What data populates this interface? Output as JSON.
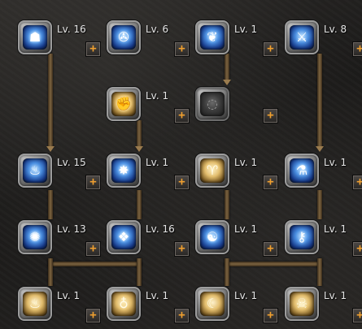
{
  "skill_tree": {
    "nodes": [
      {
        "id": "r1c1",
        "level_label": "Lv. 16",
        "plus_label": "+",
        "icon": "spirit-bust-icon",
        "style": "blue"
      },
      {
        "id": "r1c2",
        "level_label": "Lv. 6",
        "plus_label": "+",
        "icon": "spinning-wheel-icon",
        "style": "blue"
      },
      {
        "id": "r1c3",
        "level_label": "Lv. 1",
        "plus_label": "+",
        "icon": "rabbit-spirit-icon",
        "style": "blue"
      },
      {
        "id": "r1c4",
        "level_label": "Lv. 8",
        "plus_label": "+",
        "icon": "sword-icon",
        "style": "blue"
      },
      {
        "id": "r2c2",
        "level_label": "Lv. 1",
        "plus_label": "+",
        "icon": "fist-strike-icon",
        "style": "gold"
      },
      {
        "id": "r2c3",
        "level_label": "",
        "plus_label": "+",
        "icon": "locked-halo-icon",
        "style": "locked"
      },
      {
        "id": "r3c1",
        "level_label": "Lv. 15",
        "plus_label": "+",
        "icon": "spirit-summon-icon",
        "style": "blue"
      },
      {
        "id": "r3c2",
        "level_label": "Lv. 1",
        "plus_label": "+",
        "icon": "burst-icon",
        "style": "blue"
      },
      {
        "id": "r3c3",
        "level_label": "Lv. 1",
        "plus_label": "+",
        "icon": "ram-horns-icon",
        "style": "gold"
      },
      {
        "id": "r3c4",
        "level_label": "Lv. 1",
        "plus_label": "+",
        "icon": "potion-flask-icon",
        "style": "blue"
      },
      {
        "id": "r4c1",
        "level_label": "Lv. 13",
        "plus_label": "+",
        "icon": "spirit-storm-icon",
        "style": "blue"
      },
      {
        "id": "r4c2",
        "level_label": "Lv. 16",
        "plus_label": "+",
        "icon": "crystal-shards-icon",
        "style": "blue"
      },
      {
        "id": "r4c3",
        "level_label": "Lv. 1",
        "plus_label": "+",
        "icon": "meditation-orb-icon",
        "style": "blue"
      },
      {
        "id": "r4c4",
        "level_label": "Lv. 1",
        "plus_label": "+",
        "icon": "key-staff-icon",
        "style": "blue"
      },
      {
        "id": "r5c1",
        "level_label": "Lv. 1",
        "plus_label": "+",
        "icon": "flame-bag-icon",
        "style": "gold"
      },
      {
        "id": "r5c2",
        "level_label": "Lv. 1",
        "plus_label": "+",
        "icon": "bomb-flask-icon",
        "style": "gold"
      },
      {
        "id": "r5c3",
        "level_label": "Lv. 1",
        "plus_label": "+",
        "icon": "sleep-zz-icon",
        "style": "gold"
      },
      {
        "id": "r5c4",
        "level_label": "Lv. 1",
        "plus_label": "+",
        "icon": "skull-bag-icon",
        "style": "gold"
      }
    ]
  }
}
